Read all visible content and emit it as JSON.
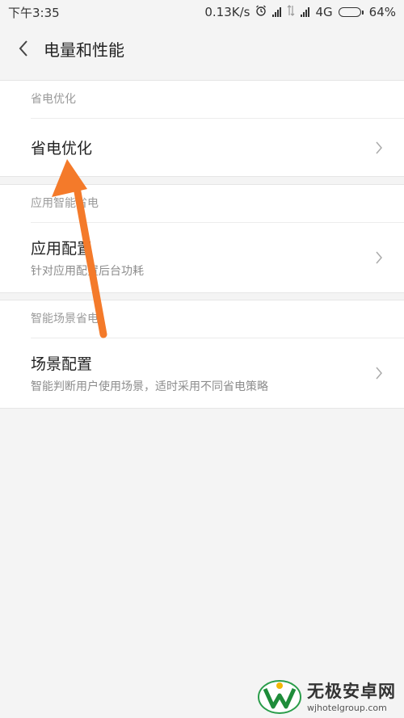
{
  "status_bar": {
    "time": "下午3:35",
    "net_speed": "0.13K/s",
    "network": "4G",
    "battery": "64%",
    "battery_level": 0.64
  },
  "header": {
    "title": "电量和性能",
    "back_icon": "chevron-left-icon"
  },
  "sections": [
    {
      "header": "省电优化",
      "item": {
        "label": "省电优化",
        "sub": ""
      }
    },
    {
      "header": "应用智能省电",
      "item": {
        "label": "应用配置",
        "sub": "针对应用配置后台功耗"
      }
    },
    {
      "header": "智能场景省电",
      "item": {
        "label": "场景配置",
        "sub": "智能判断用户使用场景，适时采用不同省电策略"
      }
    }
  ],
  "annotation": {
    "color": "#f47a2a"
  },
  "watermark": {
    "name": "无极安卓网",
    "url": "wjhotelgroup.com"
  }
}
